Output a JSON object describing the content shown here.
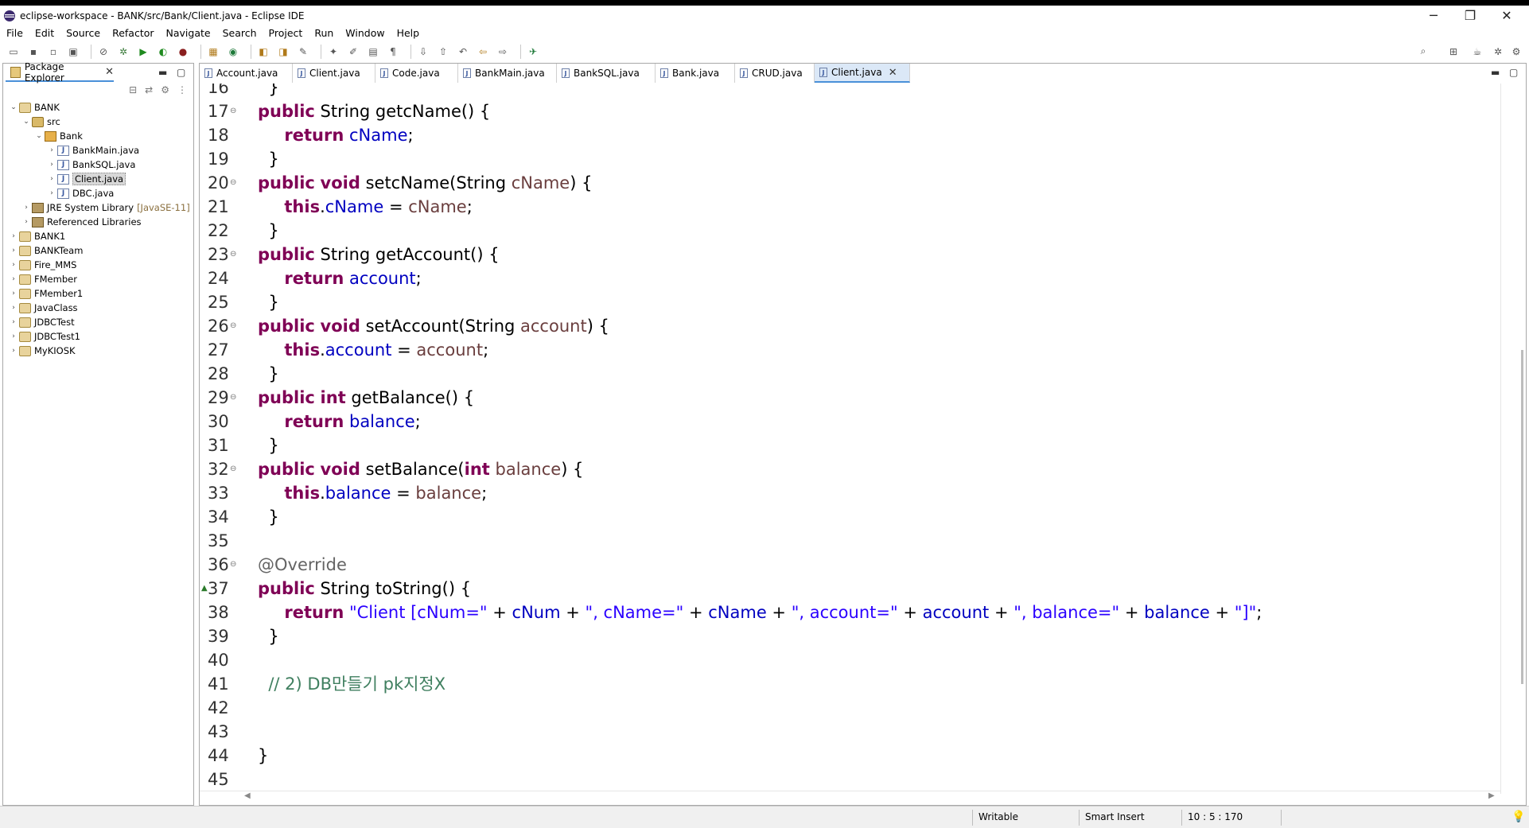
{
  "window": {
    "title": "eclipse-workspace - BANK/src/Bank/Client.java - Eclipse IDE",
    "minimize": "─",
    "restore": "❐",
    "close": "✕"
  },
  "menu": [
    "File",
    "Edit",
    "Source",
    "Refactor",
    "Navigate",
    "Search",
    "Project",
    "Run",
    "Window",
    "Help"
  ],
  "package_explorer": {
    "title": "Package Explorer",
    "tree": [
      {
        "label": "BANK",
        "depth": 0,
        "toggle": "⌄",
        "icon": "project-icon"
      },
      {
        "label": "src",
        "depth": 1,
        "toggle": "⌄",
        "icon": "source-folder-icon"
      },
      {
        "label": "Bank",
        "depth": 2,
        "toggle": "⌄",
        "icon": "package-icon"
      },
      {
        "label": "BankMain.java",
        "depth": 3,
        "toggle": "›",
        "icon": "java-file-icon"
      },
      {
        "label": "BankSQL.java",
        "depth": 3,
        "toggle": "›",
        "icon": "java-file-icon"
      },
      {
        "label": "Client.java",
        "depth": 3,
        "toggle": "›",
        "icon": "java-file-icon",
        "selected": true
      },
      {
        "label": "DBC.java",
        "depth": 3,
        "toggle": "›",
        "icon": "java-file-icon"
      },
      {
        "label": "JRE System Library",
        "decor": "[JavaSE-11]",
        "depth": 1,
        "toggle": "›",
        "icon": "library-icon"
      },
      {
        "label": "Referenced Libraries",
        "depth": 1,
        "toggle": "›",
        "icon": "library-icon"
      },
      {
        "label": "BANK1",
        "depth": 0,
        "toggle": "›",
        "icon": "project-icon"
      },
      {
        "label": "BANKTeam",
        "depth": 0,
        "toggle": "›",
        "icon": "project-icon"
      },
      {
        "label": "Fire_MMS",
        "depth": 0,
        "toggle": "›",
        "icon": "project-icon"
      },
      {
        "label": "FMember",
        "depth": 0,
        "toggle": "›",
        "icon": "project-icon"
      },
      {
        "label": "FMember1",
        "depth": 0,
        "toggle": "›",
        "icon": "project-icon"
      },
      {
        "label": "JavaClass",
        "depth": 0,
        "toggle": "›",
        "icon": "project-icon"
      },
      {
        "label": "JDBCTest",
        "depth": 0,
        "toggle": "›",
        "icon": "project-icon"
      },
      {
        "label": "JDBCTest1",
        "depth": 0,
        "toggle": "›",
        "icon": "project-icon"
      },
      {
        "label": "MyKIOSK",
        "depth": 0,
        "toggle": "›",
        "icon": "project-icon"
      }
    ]
  },
  "editor": {
    "tabs": [
      {
        "label": "Account.java"
      },
      {
        "label": "Client.java"
      },
      {
        "label": "Code.java"
      },
      {
        "label": "BankMain.java"
      },
      {
        "label": "BankSQL.java"
      },
      {
        "label": "Bank.java"
      },
      {
        "label": "CRUD.java"
      },
      {
        "label": "Client.java",
        "active": true
      }
    ],
    "lines": [
      {
        "n": "16",
        "parts": [
          [
            "",
            "  }"
          ]
        ]
      },
      {
        "n": "17",
        "fold": true,
        "parts": [
          [
            "kw",
            "public"
          ],
          [
            "",
            " String getcName() {"
          ]
        ]
      },
      {
        "n": "18",
        "parts": [
          [
            "",
            "     "
          ],
          [
            "kw",
            "return"
          ],
          [
            "",
            " "
          ],
          [
            "fld",
            "cName"
          ],
          [
            "",
            ";"
          ]
        ]
      },
      {
        "n": "19",
        "parts": [
          [
            "",
            "  }"
          ]
        ]
      },
      {
        "n": "20",
        "fold": true,
        "parts": [
          [
            "kw",
            "public"
          ],
          [
            "",
            " "
          ],
          [
            "kw",
            "void"
          ],
          [
            "",
            " setcName(String "
          ],
          [
            "prm",
            "cName"
          ],
          [
            "",
            ") {"
          ]
        ]
      },
      {
        "n": "21",
        "parts": [
          [
            "",
            "     "
          ],
          [
            "kw",
            "this"
          ],
          [
            "",
            "."
          ],
          [
            "fld",
            "cName"
          ],
          [
            "",
            " = "
          ],
          [
            "prm",
            "cName"
          ],
          [
            "",
            ";"
          ]
        ]
      },
      {
        "n": "22",
        "parts": [
          [
            "",
            "  }"
          ]
        ]
      },
      {
        "n": "23",
        "fold": true,
        "parts": [
          [
            "kw",
            "public"
          ],
          [
            "",
            " String getAccount() {"
          ]
        ]
      },
      {
        "n": "24",
        "parts": [
          [
            "",
            "     "
          ],
          [
            "kw",
            "return"
          ],
          [
            "",
            " "
          ],
          [
            "fld",
            "account"
          ],
          [
            "",
            ";"
          ]
        ]
      },
      {
        "n": "25",
        "parts": [
          [
            "",
            "  }"
          ]
        ]
      },
      {
        "n": "26",
        "fold": true,
        "parts": [
          [
            "kw",
            "public"
          ],
          [
            "",
            " "
          ],
          [
            "kw",
            "void"
          ],
          [
            "",
            " setAccount(String "
          ],
          [
            "prm",
            "account"
          ],
          [
            "",
            ") {"
          ]
        ]
      },
      {
        "n": "27",
        "parts": [
          [
            "",
            "     "
          ],
          [
            "kw",
            "this"
          ],
          [
            "",
            "."
          ],
          [
            "fld",
            "account"
          ],
          [
            "",
            " = "
          ],
          [
            "prm",
            "account"
          ],
          [
            "",
            ";"
          ]
        ]
      },
      {
        "n": "28",
        "parts": [
          [
            "",
            "  }"
          ]
        ]
      },
      {
        "n": "29",
        "fold": true,
        "parts": [
          [
            "kw",
            "public"
          ],
          [
            "",
            " "
          ],
          [
            "kw",
            "int"
          ],
          [
            "",
            " getBalance() {"
          ]
        ]
      },
      {
        "n": "30",
        "parts": [
          [
            "",
            "     "
          ],
          [
            "kw",
            "return"
          ],
          [
            "",
            " "
          ],
          [
            "fld",
            "balance"
          ],
          [
            "",
            ";"
          ]
        ]
      },
      {
        "n": "31",
        "parts": [
          [
            "",
            "  }"
          ]
        ]
      },
      {
        "n": "32",
        "fold": true,
        "parts": [
          [
            "kw",
            "public"
          ],
          [
            "",
            " "
          ],
          [
            "kw",
            "void"
          ],
          [
            "",
            " setBalance("
          ],
          [
            "kw",
            "int"
          ],
          [
            "",
            " "
          ],
          [
            "prm",
            "balance"
          ],
          [
            "",
            ") {"
          ]
        ]
      },
      {
        "n": "33",
        "parts": [
          [
            "",
            "     "
          ],
          [
            "kw",
            "this"
          ],
          [
            "",
            "."
          ],
          [
            "fld",
            "balance"
          ],
          [
            "",
            " = "
          ],
          [
            "prm",
            "balance"
          ],
          [
            "",
            ";"
          ]
        ]
      },
      {
        "n": "34",
        "parts": [
          [
            "",
            "  }"
          ]
        ]
      },
      {
        "n": "35",
        "parts": [
          [
            "",
            ""
          ]
        ]
      },
      {
        "n": "36",
        "fold": true,
        "parts": [
          [
            "ann",
            "@Override"
          ]
        ]
      },
      {
        "n": "37",
        "override": true,
        "parts": [
          [
            "kw",
            "public"
          ],
          [
            "",
            " String toString() {"
          ]
        ]
      },
      {
        "n": "38",
        "parts": [
          [
            "",
            "     "
          ],
          [
            "kw",
            "return"
          ],
          [
            "",
            " "
          ],
          [
            "str",
            "\"Client [cNum=\""
          ],
          [
            "",
            " + "
          ],
          [
            "fld",
            "cNum"
          ],
          [
            "",
            " + "
          ],
          [
            "str",
            "\", cName=\""
          ],
          [
            "",
            " + "
          ],
          [
            "fld",
            "cName"
          ],
          [
            "",
            " + "
          ],
          [
            "str",
            "\", account=\""
          ],
          [
            "",
            " + "
          ],
          [
            "fld",
            "account"
          ],
          [
            "",
            " + "
          ],
          [
            "str",
            "\", balance=\""
          ],
          [
            "",
            " + "
          ],
          [
            "fld",
            "balance"
          ],
          [
            "",
            " + "
          ],
          [
            "str",
            "\"]\""
          ],
          [
            "",
            ";"
          ]
        ]
      },
      {
        "n": "39",
        "parts": [
          [
            "",
            "  }"
          ]
        ]
      },
      {
        "n": "40",
        "parts": [
          [
            "",
            ""
          ]
        ]
      },
      {
        "n": "41",
        "parts": [
          [
            "cmt",
            "  // 2) DB만들기 pk지정X"
          ]
        ]
      },
      {
        "n": "42",
        "parts": [
          [
            "",
            ""
          ]
        ]
      },
      {
        "n": "43",
        "parts": [
          [
            "",
            ""
          ]
        ]
      },
      {
        "n": "44",
        "parts": [
          [
            "",
            "}"
          ]
        ]
      },
      {
        "n": "45",
        "parts": [
          [
            "",
            ""
          ]
        ]
      }
    ]
  },
  "status": {
    "writable": "Writable",
    "insert_mode": "Smart Insert",
    "position": "10 : 5 : 170"
  },
  "colors": {
    "keyword": "#7f0055",
    "field": "#0000c0",
    "parameter": "#6a3e3e",
    "string": "#2a00ff",
    "annotation": "#646464",
    "comment": "#3f7f5f",
    "active_tab": "#dbe8f7"
  }
}
